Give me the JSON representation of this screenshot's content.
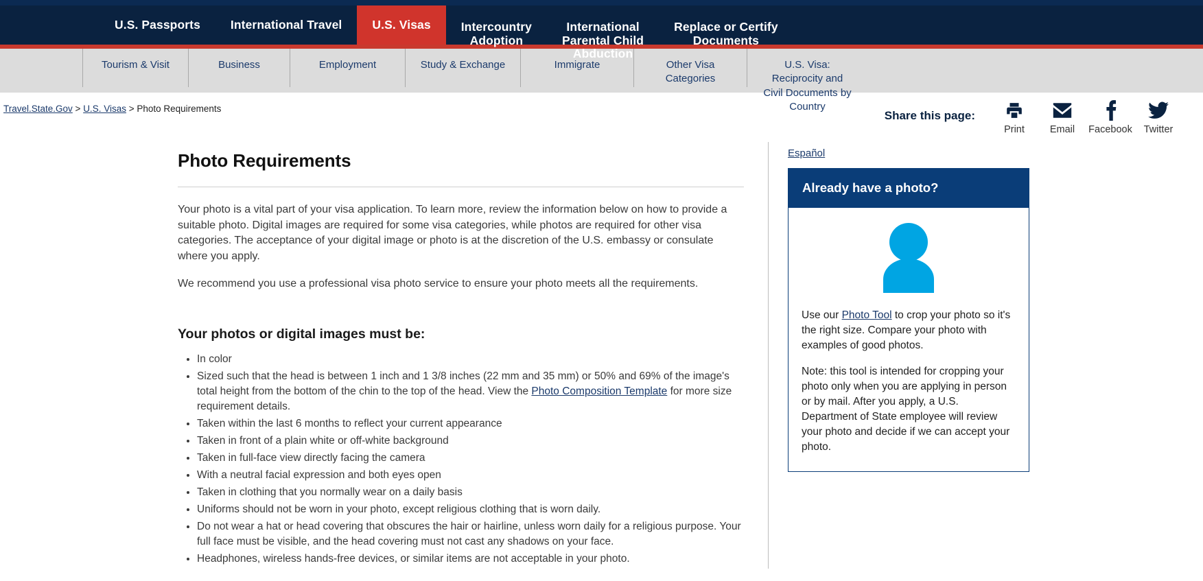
{
  "mainnav": {
    "items": [
      {
        "label": "U.S. Passports",
        "active": false
      },
      {
        "label": "International Travel",
        "active": false
      },
      {
        "label": "U.S. Visas",
        "active": true
      },
      {
        "label": "Intercountry\nAdoption",
        "active": false
      },
      {
        "label": "International\nParental Child\nAbduction",
        "active": false
      },
      {
        "label": "Replace or Certify\nDocuments",
        "active": false
      }
    ],
    "active_color": "#d0342c",
    "bar_color": "#0a2240",
    "accent_color": "#c9392e"
  },
  "subnav": {
    "items": [
      {
        "label": "Tourism & Visit"
      },
      {
        "label": "Business"
      },
      {
        "label": "Employment"
      },
      {
        "label": "Study & Exchange"
      },
      {
        "label": "Immigrate"
      },
      {
        "label": "Other Visa Categories"
      },
      {
        "label": "U.S. Visa: Reciprocity and Civil Documents by Country"
      }
    ]
  },
  "breadcrumb": {
    "home": "Travel.State.Gov",
    "sep1": " > ",
    "section": "U.S. Visas",
    "sep2": " > ",
    "current": "Photo Requirements"
  },
  "share": {
    "label": "Share this page:",
    "buttons": [
      {
        "name": "Print",
        "icon": "printer-icon"
      },
      {
        "name": "Email",
        "icon": "envelope-icon"
      },
      {
        "name": "Facebook",
        "icon": "facebook-icon"
      },
      {
        "name": "Twitter",
        "icon": "twitter-icon"
      }
    ],
    "icon_color": "#0a2240"
  },
  "main": {
    "title": "Photo Requirements",
    "intro_1": "Your photo is a vital part of your visa application. To learn more, review the information below on how to provide a suitable photo. Digital images are required for some visa categories, while photos are required for other visa categories. The acceptance of your digital image or photo is at the discretion of the U.S. embassy or consulate where you apply.",
    "intro_2": "We recommend you use a professional visa photo service to ensure your photo meets all the requirements.",
    "list_heading": "Your photos or digital images must be:",
    "requirements": [
      {
        "text_before": "In color",
        "link": "",
        "text_after": ""
      },
      {
        "text_before": "Sized such that the head is between 1 inch and 1 3/8 inches (22 mm and 35 mm) or 50% and 69% of the image's total height from the bottom of the chin to the top of the head. View the ",
        "link": "Photo Composition Template",
        "text_after": " for more size requirement details."
      },
      {
        "text_before": "Taken within the last 6 months to reflect your current appearance",
        "link": "",
        "text_after": ""
      },
      {
        "text_before": "Taken in front of a plain white or off-white background",
        "link": "",
        "text_after": ""
      },
      {
        "text_before": "Taken in full-face view directly facing the camera",
        "link": "",
        "text_after": ""
      },
      {
        "text_before": "With a neutral facial expression and both eyes open",
        "link": "",
        "text_after": ""
      },
      {
        "text_before": "Taken in clothing that you normally wear on a daily basis",
        "link": "",
        "text_after": ""
      },
      {
        "text_before": "Uniforms should not be worn in your photo, except religious clothing that is worn daily.",
        "link": "",
        "text_after": ""
      },
      {
        "text_before": "Do not wear a hat or head covering that obscures the hair or hairline, unless worn daily for a religious purpose. Your full face must be visible, and the head covering must not cast any shadows on your face.",
        "link": "",
        "text_after": ""
      },
      {
        "text_before": "Headphones, wireless hands-free devices, or similar items are not acceptable in your photo.",
        "link": "",
        "text_after": ""
      }
    ]
  },
  "aside": {
    "espanol": "Español",
    "panel_title": "Already have a photo?",
    "avatar_icon": "person-avatar-icon",
    "avatar_color": "#00A5E3",
    "panel_head_color": "#0a3d78",
    "para_1_before": "Use our ",
    "para_1_link": "Photo Tool",
    "para_1_after": " to crop your photo so it's the right size. Compare your photo with examples of good photos.",
    "para_2": "Note: this tool is intended for cropping your photo only when you are applying in person or by mail. After you apply, a U.S. Department of State employee will review your photo and decide if we can accept your photo."
  }
}
